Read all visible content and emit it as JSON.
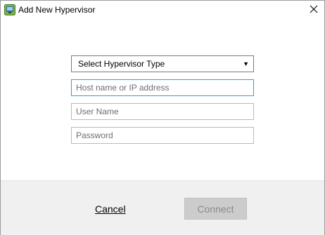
{
  "window": {
    "title": "Add New Hypervisor",
    "icon": "hypervisor-app-icon",
    "close_icon": "close-icon"
  },
  "form": {
    "hypervisor_type": {
      "selected": "Select Hypervisor Type",
      "arrow": "▼"
    },
    "host": {
      "value": "",
      "placeholder": "Host name or IP address"
    },
    "username": {
      "value": "",
      "placeholder": "User Name"
    },
    "password": {
      "value": "",
      "placeholder": "Password"
    }
  },
  "footer": {
    "cancel_label": "Cancel",
    "connect_label": "Connect"
  },
  "colors": {
    "focus_border": "#3b9bd1",
    "footer_bg": "#f0f0f0",
    "disabled_button_bg": "#cccccc"
  }
}
